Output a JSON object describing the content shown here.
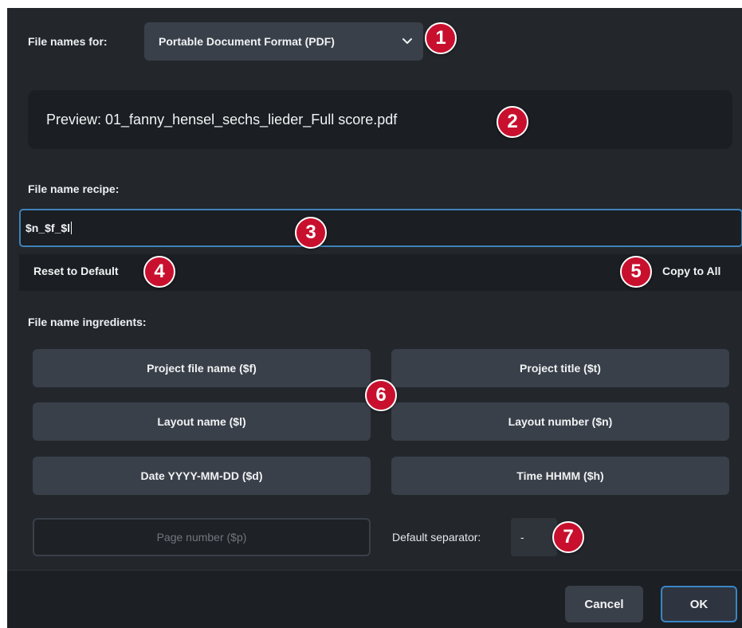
{
  "file_names_for": {
    "label": "File names for:",
    "selected": "Portable Document Format (PDF)"
  },
  "preview": {
    "text": "Preview: 01_fanny_hensel_sechs_lieder_Full score.pdf"
  },
  "recipe": {
    "label": "File name recipe:",
    "value": "$n_$f_$l"
  },
  "actions": {
    "reset": "Reset to Default",
    "copy": "Copy to All"
  },
  "ingredients": {
    "label": "File name ingredients:",
    "items": [
      "Project file name ($f)",
      "Project title ($t)",
      "Layout name ($l)",
      "Layout number ($n)",
      "Date YYYY-MM-DD ($d)",
      "Time HHMM ($h)",
      "Page number ($p)"
    ]
  },
  "separator": {
    "label": "Default separator:",
    "value": "-"
  },
  "footer": {
    "cancel": "Cancel",
    "ok": "OK"
  },
  "callouts": [
    "1",
    "2",
    "3",
    "4",
    "5",
    "6",
    "7"
  ],
  "colors": {
    "dialog_bg": "#23272c",
    "button_bg": "#3a4049",
    "focus_accent": "#3f82b8",
    "callout_red": "#c8102e"
  },
  "icons": {
    "dropdown": "chevron-down-icon"
  }
}
